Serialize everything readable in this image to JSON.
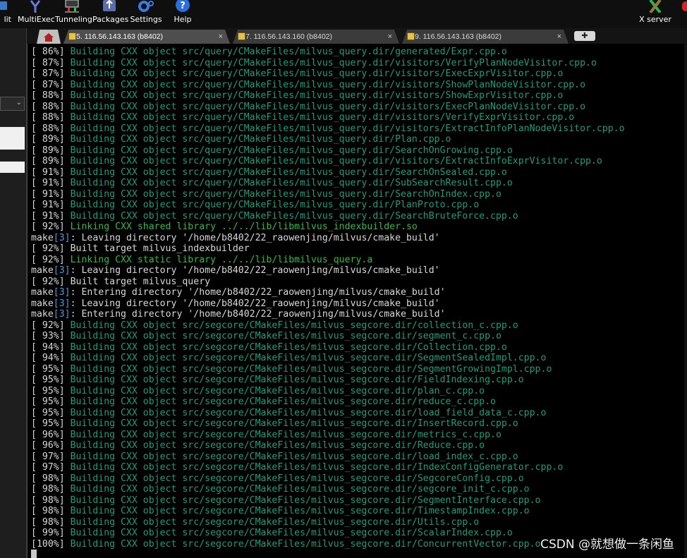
{
  "toolbar": {
    "items": [
      {
        "label": "lit",
        "icon": "split-icon"
      },
      {
        "label": "MultiExec",
        "icon": "multiexec-icon"
      },
      {
        "label": "Tunneling",
        "icon": "tunneling-icon"
      },
      {
        "label": "Packages",
        "icon": "packages-icon"
      },
      {
        "label": "Settings",
        "icon": "settings-icon"
      },
      {
        "label": "Help",
        "icon": "help-icon"
      }
    ],
    "xserver_label": "X server"
  },
  "tabs": [
    {
      "label": "5. 116.56.143.163  (b8402)",
      "active": true
    },
    {
      "label": "7. 116.56.143.160  (b8402)",
      "active": false
    },
    {
      "label": "9. 116.56.143.163  (b8402)",
      "active": false
    }
  ],
  "close_glyph": "×",
  "plus_glyph": "✚",
  "watermark": "CSDN @就想做一条闲鱼",
  "colors": {
    "green": "#25bf3f",
    "teal": "#159e7a",
    "cyan": "#3aa0dc",
    "white": "#d8d8d8"
  },
  "terminal": {
    "lines": [
      {
        "prefix": "[ 86%] ",
        "text": "Building CXX object src/query/CMakeFiles/milvus_query.dir/generated/Expr.cpp.o",
        "color": "dgreen"
      },
      {
        "prefix": "[ 87%] ",
        "text": "Building CXX object src/query/CMakeFiles/milvus_query.dir/visitors/VerifyPlanNodeVisitor.cpp.o",
        "color": "dgreen"
      },
      {
        "prefix": "[ 87%] ",
        "text": "Building CXX object src/query/CMakeFiles/milvus_query.dir/visitors/ExecExprVisitor.cpp.o",
        "color": "dgreen"
      },
      {
        "prefix": "[ 87%] ",
        "text": "Building CXX object src/query/CMakeFiles/milvus_query.dir/visitors/ShowPlanNodeVisitor.cpp.o",
        "color": "dgreen"
      },
      {
        "prefix": "[ 88%] ",
        "text": "Building CXX object src/query/CMakeFiles/milvus_query.dir/visitors/ShowExprVisitor.cpp.o",
        "color": "dgreen"
      },
      {
        "prefix": "[ 88%] ",
        "text": "Building CXX object src/query/CMakeFiles/milvus_query.dir/visitors/ExecPlanNodeVisitor.cpp.o",
        "color": "dgreen"
      },
      {
        "prefix": "[ 88%] ",
        "text": "Building CXX object src/query/CMakeFiles/milvus_query.dir/visitors/VerifyExprVisitor.cpp.o",
        "color": "dgreen"
      },
      {
        "prefix": "[ 88%] ",
        "text": "Building CXX object src/query/CMakeFiles/milvus_query.dir/visitors/ExtractInfoPlanNodeVisitor.cpp.o",
        "color": "dgreen"
      },
      {
        "prefix": "[ 89%] ",
        "text": "Building CXX object src/query/CMakeFiles/milvus_query.dir/Plan.cpp.o",
        "color": "dgreen"
      },
      {
        "prefix": "[ 89%] ",
        "text": "Building CXX object src/query/CMakeFiles/milvus_query.dir/SearchOnGrowing.cpp.o",
        "color": "dgreen"
      },
      {
        "prefix": "[ 89%] ",
        "text": "Building CXX object src/query/CMakeFiles/milvus_query.dir/visitors/ExtractInfoExprVisitor.cpp.o",
        "color": "dgreen"
      },
      {
        "prefix": "[ 91%] ",
        "text": "Building CXX object src/query/CMakeFiles/milvus_query.dir/SearchOnSealed.cpp.o",
        "color": "dgreen"
      },
      {
        "prefix": "[ 91%] ",
        "text": "Building CXX object src/query/CMakeFiles/milvus_query.dir/SubSearchResult.cpp.o",
        "color": "dgreen"
      },
      {
        "prefix": "[ 91%] ",
        "text": "Building CXX object src/query/CMakeFiles/milvus_query.dir/SearchOnIndex.cpp.o",
        "color": "dgreen"
      },
      {
        "prefix": "[ 91%] ",
        "text": "Building CXX object src/query/CMakeFiles/milvus_query.dir/PlanProto.cpp.o",
        "color": "dgreen"
      },
      {
        "prefix": "[ 91%] ",
        "text": "Building CXX object src/query/CMakeFiles/milvus_query.dir/SearchBruteForce.cpp.o",
        "color": "dgreen"
      },
      {
        "prefix": "[ 92%] ",
        "text": "Linking CXX shared library ../../lib/libmilvus_indexbuilder.so",
        "color": "green"
      },
      {
        "prefix": "make",
        "bracket": "[3]",
        "text": ": Leaving directory '/home/b8402/22_raowenjing/milvus/cmake_build'",
        "color": "white"
      },
      {
        "prefix": "[ 92%] ",
        "text": "Built target milvus_indexbuilder",
        "color": "white"
      },
      {
        "prefix": "[ 92%] ",
        "text": "Linking CXX static library ../../lib/libmilvus_query.a",
        "color": "green"
      },
      {
        "prefix": "make",
        "bracket": "[3]",
        "text": ": Leaving directory '/home/b8402/22_raowenjing/milvus/cmake_build'",
        "color": "white"
      },
      {
        "prefix": "[ 92%] ",
        "text": "Built target milvus_query",
        "color": "white"
      },
      {
        "prefix": "make",
        "bracket": "[3]",
        "text": ": Entering directory '/home/b8402/22_raowenjing/milvus/cmake_build'",
        "color": "white"
      },
      {
        "prefix": "make",
        "bracket": "[3]",
        "text": ": Leaving directory '/home/b8402/22_raowenjing/milvus/cmake_build'",
        "color": "white"
      },
      {
        "prefix": "make",
        "bracket": "[3]",
        "text": ": Entering directory '/home/b8402/22_raowenjing/milvus/cmake_build'",
        "color": "white"
      },
      {
        "prefix": "[ 92%] ",
        "text": "Building CXX object src/segcore/CMakeFiles/milvus_segcore.dir/collection_c.cpp.o",
        "color": "dgreen"
      },
      {
        "prefix": "[ 93%] ",
        "text": "Building CXX object src/segcore/CMakeFiles/milvus_segcore.dir/segment_c.cpp.o",
        "color": "dgreen"
      },
      {
        "prefix": "[ 94%] ",
        "text": "Building CXX object src/segcore/CMakeFiles/milvus_segcore.dir/Collection.cpp.o",
        "color": "dgreen"
      },
      {
        "prefix": "[ 94%] ",
        "text": "Building CXX object src/segcore/CMakeFiles/milvus_segcore.dir/SegmentSealedImpl.cpp.o",
        "color": "dgreen"
      },
      {
        "prefix": "[ 95%] ",
        "text": "Building CXX object src/segcore/CMakeFiles/milvus_segcore.dir/SegmentGrowingImpl.cpp.o",
        "color": "dgreen"
      },
      {
        "prefix": "[ 95%] ",
        "text": "Building CXX object src/segcore/CMakeFiles/milvus_segcore.dir/FieldIndexing.cpp.o",
        "color": "dgreen"
      },
      {
        "prefix": "[ 95%] ",
        "text": "Building CXX object src/segcore/CMakeFiles/milvus_segcore.dir/plan_c.cpp.o",
        "color": "dgreen"
      },
      {
        "prefix": "[ 95%] ",
        "text": "Building CXX object src/segcore/CMakeFiles/milvus_segcore.dir/reduce_c.cpp.o",
        "color": "dgreen"
      },
      {
        "prefix": "[ 95%] ",
        "text": "Building CXX object src/segcore/CMakeFiles/milvus_segcore.dir/load_field_data_c.cpp.o",
        "color": "dgreen"
      },
      {
        "prefix": "[ 95%] ",
        "text": "Building CXX object src/segcore/CMakeFiles/milvus_segcore.dir/InsertRecord.cpp.o",
        "color": "dgreen"
      },
      {
        "prefix": "[ 96%] ",
        "text": "Building CXX object src/segcore/CMakeFiles/milvus_segcore.dir/metrics_c.cpp.o",
        "color": "dgreen"
      },
      {
        "prefix": "[ 96%] ",
        "text": "Building CXX object src/segcore/CMakeFiles/milvus_segcore.dir/Reduce.cpp.o",
        "color": "dgreen"
      },
      {
        "prefix": "[ 97%] ",
        "text": "Building CXX object src/segcore/CMakeFiles/milvus_segcore.dir/load_index_c.cpp.o",
        "color": "dgreen"
      },
      {
        "prefix": "[ 97%] ",
        "text": "Building CXX object src/segcore/CMakeFiles/milvus_segcore.dir/IndexConfigGenerator.cpp.o",
        "color": "dgreen"
      },
      {
        "prefix": "[ 98%] ",
        "text": "Building CXX object src/segcore/CMakeFiles/milvus_segcore.dir/SegcoreConfig.cpp.o",
        "color": "dgreen"
      },
      {
        "prefix": "[ 98%] ",
        "text": "Building CXX object src/segcore/CMakeFiles/milvus_segcore.dir/segcore_init_c.cpp.o",
        "color": "dgreen"
      },
      {
        "prefix": "[ 98%] ",
        "text": "Building CXX object src/segcore/CMakeFiles/milvus_segcore.dir/SegmentInterface.cpp.o",
        "color": "dgreen"
      },
      {
        "prefix": "[ 98%] ",
        "text": "Building CXX object src/segcore/CMakeFiles/milvus_segcore.dir/TimestampIndex.cpp.o",
        "color": "dgreen"
      },
      {
        "prefix": "[ 98%] ",
        "text": "Building CXX object src/segcore/CMakeFiles/milvus_segcore.dir/Utils.cpp.o",
        "color": "dgreen"
      },
      {
        "prefix": "[ 99%] ",
        "text": "Building CXX object src/segcore/CMakeFiles/milvus_segcore.dir/ScalarIndex.cpp.o",
        "color": "dgreen"
      },
      {
        "prefix": "[100%] ",
        "text": "Building CXX object src/segcore/CMakeFiles/milvus_segcore.dir/ConcurrentVector.cpp.o",
        "color": "dgreen"
      }
    ]
  }
}
